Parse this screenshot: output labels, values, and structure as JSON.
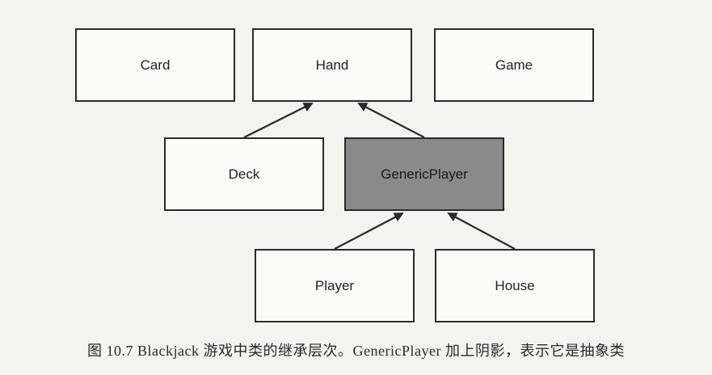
{
  "diagram": {
    "nodes": {
      "card": {
        "label": "Card"
      },
      "hand": {
        "label": "Hand"
      },
      "game": {
        "label": "Game"
      },
      "deck": {
        "label": "Deck"
      },
      "generic_player": {
        "label": "GenericPlayer",
        "abstract": true,
        "fill": "#8a8a8a"
      },
      "player": {
        "label": "Player"
      },
      "house": {
        "label": "House"
      }
    },
    "edges": [
      {
        "from": "deck",
        "to": "hand"
      },
      {
        "from": "generic_player",
        "to": "hand"
      },
      {
        "from": "player",
        "to": "generic_player"
      },
      {
        "from": "house",
        "to": "generic_player"
      }
    ],
    "caption": "图 10.7  Blackjack 游戏中类的继承层次。GenericPlayer 加上阴影，表示它是抽象类"
  }
}
